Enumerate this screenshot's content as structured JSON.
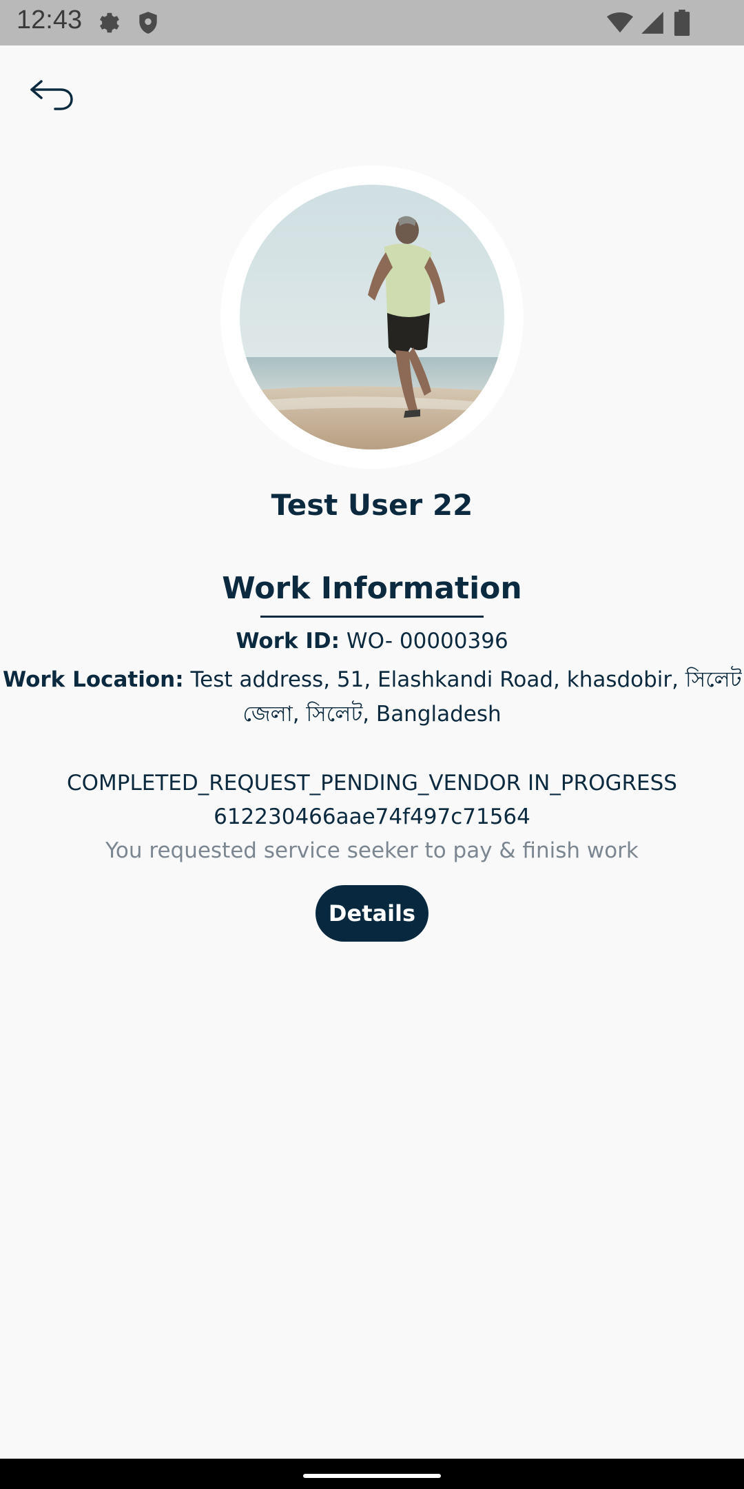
{
  "status_bar": {
    "time": "12:43",
    "icons": [
      "gear-icon",
      "shield-icon",
      "wifi-icon",
      "signal-icon",
      "battery-icon"
    ]
  },
  "header": {
    "back_icon": "back-arrow-icon"
  },
  "profile": {
    "name": "Test User 22",
    "avatar_description": "photo"
  },
  "work_info": {
    "title": "Work Information",
    "work_id_label": "Work ID:",
    "work_id_value": "WO- 00000396",
    "location_label": "Work Location:",
    "location_value_line1": "Test address, 51, Elashkandi Road, khasdobir, সিলেট",
    "location_value_line2": "জেলা, সিলেট, Bangladesh"
  },
  "status": {
    "codes": "COMPLETED_REQUEST_PENDING_VENDOR  IN_PROGRESS",
    "reference_id": "612230466aae74f497c71564",
    "message": "You requested service seeker to pay & finish work"
  },
  "actions": {
    "details_label": "Details"
  },
  "colors": {
    "primary": "#07283f",
    "background": "#f9f9f9",
    "muted_text": "#7b8690"
  }
}
